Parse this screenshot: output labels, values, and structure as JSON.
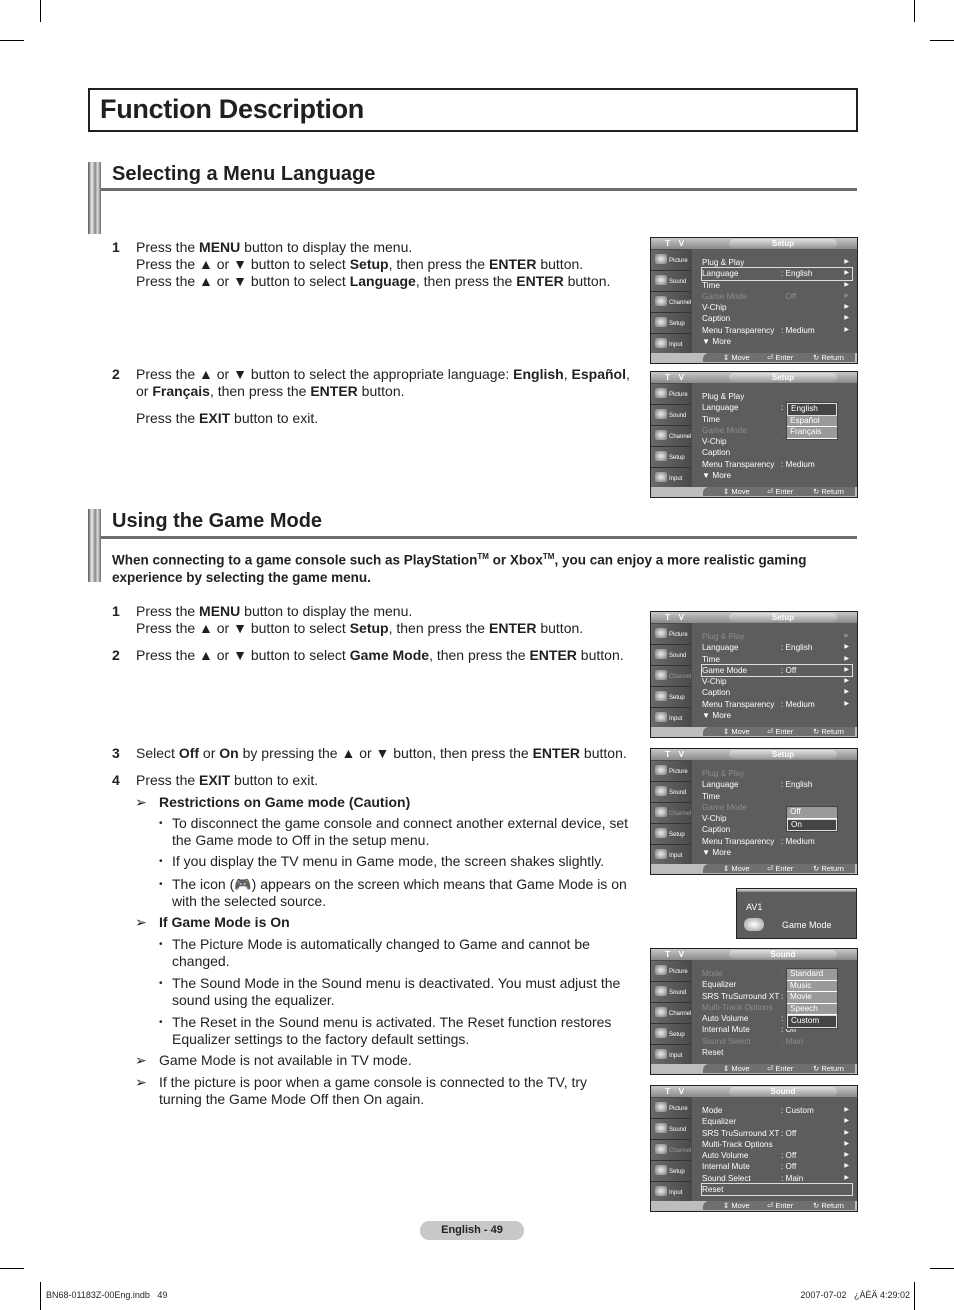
{
  "page_title": "Function Description",
  "sections": {
    "language": {
      "title": "Selecting a Menu Language",
      "steps": [
        {
          "num": "1",
          "lines": [
            [
              "Press the ",
              {
                "b": "MENU"
              },
              " button to display the menu."
            ],
            [
              "Press the ▲ or ▼ button to select ",
              {
                "b": "Setup"
              },
              ", then press the ",
              {
                "b": "ENTER"
              },
              " button."
            ],
            [
              "Press the ▲ or ▼ button to select ",
              {
                "b": "Language"
              },
              ", then press the ",
              {
                "b": "ENTER"
              },
              " button."
            ]
          ]
        },
        {
          "num": "2",
          "lines": [
            [
              "Press the ▲ or ▼ button to select the appropriate language: ",
              {
                "b": "English"
              },
              ", ",
              {
                "b": "Español"
              },
              ", or ",
              {
                "b": "Français"
              },
              ", then press the ",
              {
                "b": "ENTER"
              },
              " button."
            ]
          ]
        },
        {
          "num": "",
          "lines": [
            [
              "Press the ",
              {
                "b": "EXIT"
              },
              " button to exit."
            ]
          ]
        }
      ]
    },
    "game": {
      "title": "Using the Game Mode",
      "intro": "When connecting to a game console such as PlayStation",
      "intro_tm1": "TM",
      "intro_mid": " or Xbox",
      "intro_tm2": "TM",
      "intro_end": ", you can enjoy a more realistic gaming experience by selecting the game menu.",
      "steps": [
        {
          "num": "1",
          "lines": [
            [
              "Press the ",
              {
                "b": "MENU"
              },
              " button to display the menu."
            ],
            [
              "Press the ▲ or ▼ button to select ",
              {
                "b": "Setup"
              },
              ", then press the ",
              {
                "b": "ENTER"
              },
              " button."
            ]
          ]
        },
        {
          "num": "2",
          "lines": [
            [
              "Press the ▲ or ▼ button to select ",
              {
                "b": "Game Mode"
              },
              ", then press the ",
              {
                "b": "ENTER"
              },
              " button."
            ]
          ]
        },
        {
          "num": "3",
          "lines": [
            [
              "Select ",
              {
                "b": "Off"
              },
              " or ",
              {
                "b": "On"
              },
              " by pressing the ▲ or ▼ button, then press the ",
              {
                "b": "ENTER"
              },
              " button."
            ]
          ]
        },
        {
          "num": "4",
          "lines": [
            [
              "Press the ",
              {
                "b": "EXIT"
              },
              " button to exit."
            ]
          ]
        }
      ],
      "notes": {
        "restrictions_title": "Restrictions on Game mode (Caution)",
        "restrictions": [
          "To disconnect the game console and connect another external device, set the Game mode to Off in the setup menu.",
          "If you display the TV menu in Game mode, the screen shakes slightly.",
          "The icon (🎮) appears on the screen which means that Game Mode is on with the selected source."
        ],
        "on_title": "If Game Mode is On",
        "on_items": [
          "The Picture Mode is automatically changed to Game and cannot be changed.",
          "The Sound Mode in the Sound menu is deactivated. You must adjust the sound using the equalizer.",
          "The Reset in the Sound menu is activated. The Reset function restores Equalizer settings to the factory default settings."
        ],
        "tv_mode": "Game Mode is not available in TV mode.",
        "poor_picture": "If the picture is poor when a game console is connected to the TV, try turning the Game Mode Off then On again."
      }
    }
  },
  "tv_common": {
    "tv_label": "T V",
    "sidebar": [
      "Picture",
      "Sound",
      "Channel",
      "Setup",
      "Input"
    ],
    "footer": {
      "move": "Move",
      "enter": "Enter",
      "return": "Return"
    }
  },
  "menus": [
    {
      "id": "setup-language",
      "title": "Setup",
      "dim_sidebar": [],
      "rows": [
        {
          "label": "Plug & Play",
          "value": "",
          "arrow": true
        },
        {
          "label": "Language",
          "value": ": English",
          "arrow": true,
          "selected": true
        },
        {
          "label": "Time",
          "value": "",
          "arrow": true
        },
        {
          "label": "Game Mode",
          "value": ": Off",
          "arrow": true,
          "dim": true
        },
        {
          "label": "V-Chip",
          "value": "",
          "arrow": true
        },
        {
          "label": "Caption",
          "value": "",
          "arrow": true
        },
        {
          "label": "Menu Transparency",
          "value": ": Medium",
          "arrow": true
        },
        {
          "label": "▼ More",
          "value": "",
          "arrow": false
        }
      ]
    },
    {
      "id": "setup-language-open",
      "title": "Setup",
      "dim_sidebar": [],
      "rows": [
        {
          "label": "Plug & Play",
          "value": ""
        },
        {
          "label": "Language",
          "value": ":"
        },
        {
          "label": "Time",
          "value": ""
        },
        {
          "label": "Game Mode",
          "value": ":",
          "dim": true
        },
        {
          "label": "V-Chip",
          "value": ""
        },
        {
          "label": "Caption",
          "value": ""
        },
        {
          "label": "Menu Transparency",
          "value": ": Medium"
        },
        {
          "label": "▼ More",
          "value": ""
        }
      ],
      "dropdown": {
        "options": [
          "English",
          "Español",
          "Français"
        ],
        "current": 0
      }
    },
    {
      "id": "setup-gamemode",
      "title": "Setup",
      "dim_sidebar": [
        2
      ],
      "rows": [
        {
          "label": "Plug & Play",
          "value": "",
          "arrow": true,
          "dim": true
        },
        {
          "label": "Language",
          "value": ": English",
          "arrow": true
        },
        {
          "label": "Time",
          "value": "",
          "arrow": true
        },
        {
          "label": "Game Mode",
          "value": ": Off",
          "arrow": true,
          "selected": true
        },
        {
          "label": "V-Chip",
          "value": "",
          "arrow": true
        },
        {
          "label": "Caption",
          "value": "",
          "arrow": true
        },
        {
          "label": "Menu Transparency",
          "value": ": Medium",
          "arrow": true
        },
        {
          "label": "▼ More",
          "value": ""
        }
      ]
    },
    {
      "id": "setup-gamemode-open",
      "title": "Setup",
      "dim_sidebar": [
        2
      ],
      "rows": [
        {
          "label": "Plug & Play",
          "value": "",
          "dim": true
        },
        {
          "label": "Language",
          "value": ": English"
        },
        {
          "label": "Time",
          "value": ""
        },
        {
          "label": "Game Mode",
          "value": ":",
          "dim": true
        },
        {
          "label": "V-Chip",
          "value": ""
        },
        {
          "label": "Caption",
          "value": ""
        },
        {
          "label": "Menu Transparency",
          "value": ": Medium"
        },
        {
          "label": "▼ More",
          "value": ""
        }
      ],
      "dropdown": {
        "options": [
          "Off",
          "On"
        ],
        "current": 1
      }
    },
    {
      "id": "sound-mode-open",
      "title": "Sound",
      "dim_sidebar": [],
      "rows": [
        {
          "label": "Mode",
          "value": ":",
          "dim": true
        },
        {
          "label": "Equalizer",
          "value": ""
        },
        {
          "label": "SRS TruSurround XT",
          "value": ":"
        },
        {
          "label": "Multi-Track Options",
          "value": "",
          "dim": true
        },
        {
          "label": "Auto Volume",
          "value": ":"
        },
        {
          "label": "Internal Mute",
          "value": ": Off"
        },
        {
          "label": "Sound Select",
          "value": ": Main",
          "dim": true
        },
        {
          "label": "Reset",
          "value": ""
        }
      ],
      "dropdown": {
        "options": [
          "Standard",
          "Music",
          "Movie",
          "Speech",
          "Custom"
        ],
        "current": 4
      }
    },
    {
      "id": "sound-reset",
      "title": "Sound",
      "dim_sidebar": [
        2
      ],
      "rows": [
        {
          "label": "Mode",
          "value": ": Custom",
          "arrow": true
        },
        {
          "label": "Equalizer",
          "value": "",
          "arrow": true
        },
        {
          "label": "SRS TruSurround XT",
          "value": ": Off",
          "arrow": true
        },
        {
          "label": "Multi-Track Options",
          "value": "",
          "arrow": true
        },
        {
          "label": "Auto Volume",
          "value": ": Off",
          "arrow": true
        },
        {
          "label": "Internal Mute",
          "value": ": Off",
          "arrow": true
        },
        {
          "label": "Sound Select",
          "value": ": Main",
          "arrow": true
        },
        {
          "label": "Reset",
          "value": "",
          "selected": true
        }
      ]
    }
  ],
  "game_osd": {
    "source": "AV1",
    "label": "Game Mode"
  },
  "footer": {
    "page": "English - 49",
    "file": "BN68-01183Z-00Eng.indb   49",
    "stamp": "2007-07-02   ¿ÀÈÄ 4:29:02"
  }
}
